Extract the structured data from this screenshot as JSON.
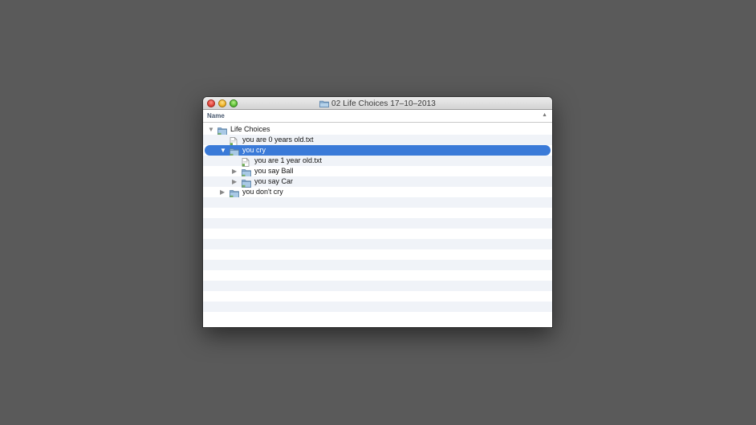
{
  "window": {
    "title": "02 Life Choices 17–10–2013"
  },
  "header": {
    "column_name": "Name",
    "sort_indicator": "▲"
  },
  "tree": [
    {
      "label": "Life Choices",
      "type": "folder",
      "depth": 0,
      "expanded": true,
      "disclosure": "▼",
      "selected": false
    },
    {
      "label": "you are 0 years old.txt",
      "type": "file",
      "depth": 1,
      "disclosure": "",
      "selected": false
    },
    {
      "label": "you cry",
      "type": "folder",
      "depth": 1,
      "expanded": true,
      "disclosure": "▼",
      "selected": true
    },
    {
      "label": "you are 1 year old.txt",
      "type": "file",
      "depth": 2,
      "disclosure": "",
      "selected": false
    },
    {
      "label": "you say Ball",
      "type": "folder",
      "depth": 2,
      "expanded": false,
      "disclosure": "▶",
      "selected": false
    },
    {
      "label": "you say Car",
      "type": "folder",
      "depth": 2,
      "expanded": false,
      "disclosure": "▶",
      "selected": false
    },
    {
      "label": "you don't cry",
      "type": "folder",
      "depth": 1,
      "expanded": false,
      "disclosure": "▶",
      "selected": false
    }
  ],
  "colors": {
    "desktop": "#5a5a5a",
    "selection": "#3a7ad8",
    "stripe": "#f0f3f8",
    "folder": "#8fb3d3"
  }
}
